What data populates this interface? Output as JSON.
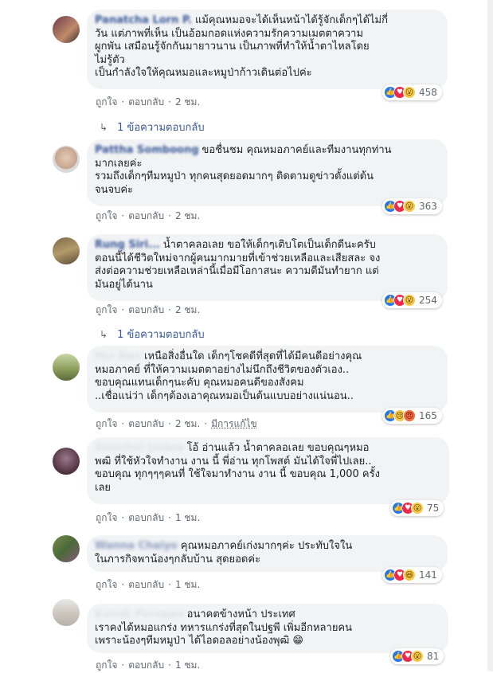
{
  "common": {
    "like_label": "ถูกใจ",
    "reply_label": "ตอบกลับ",
    "separator": "·"
  },
  "comments": [
    {
      "author": "Panatcha Lorn P.",
      "text": "แม้คุณหมอจะได้เห็นหน้าได้รู้จักเด็กๆได้ไม่กี่\nวัน แต่ภาพที่เห็น เป็นอ้อมกอดแห่งความรักความเมตตาความ\nผูกพัน เสมือนรู้จักกันมายาวนาน เป็นภาพที่ทำให้น้ำตาไหลโดย\nไม่รู้ตัว\nเป็นกำลังใจให้คุณหมอและหมูป่าก้าวเดินต่อไปค่ะ",
      "time": "2 ชม.",
      "reactions": {
        "icons": [
          "like",
          "love",
          "wow"
        ],
        "count": "458"
      },
      "replies": "1 ข้อความตอบกลับ"
    },
    {
      "author": "Pattha Somboong",
      "text": "ขอชื่นชม คุณหมอภาคย์และทีมงานทุกท่าน\nมากเลยค่ะ\nรวมถึงเด็กๆทีมหมูป่า ทุกคนสุดยอดมากๆ ติดตามดูข่าวตั้งแต่ต้น\nจนจบค่ะ",
      "time": "2 ชม.",
      "reactions": {
        "icons": [
          "like",
          "love",
          "wow"
        ],
        "count": "363"
      }
    },
    {
      "author": "Rung Siri...",
      "text": "น้ำตาคลอเลย ขอให้เด็กๆเติบโตเป็นเด็กดีนะครับ\nตอนนี้ได้ชีวิตใหม่จากผู้คนมากมายที่เข้าช่วยเหลือและเสียสละ จง\nส่งต่อความช่วยเหลือเหล่านี้เมื่อมีโอกาสนะ ความดีมันทำยาก แต่\nมันอยู่ได้นาน",
      "time": "2 ชม.",
      "reactions": {
        "icons": [
          "like",
          "love",
          "wow"
        ],
        "count": "254"
      },
      "replies": "1 ข้อความตอบกลับ"
    },
    {
      "author": "Nui Nan",
      "text": "เหนือสิ่งอื่นใด เด็กๆโชคดีที่สุดที่ได้มีคนดีอย่างคุณ\nหมอภาคย์ ที่ให้ความเมตตาอย่างไม่นึกถึงชีวิตของตัวเอง..\nขอบคุณแทนเด็กๆนะคับ คุณหมอคนดีของสังคม\n..เชื่อแน่ว่า เด็กๆต้องเอาคุณหมอเป็นต้นแบบอย่างแน่นอน..",
      "time": "2 ชม.",
      "edited": "มีการแก้ไข",
      "reactions": {
        "icons": [
          "like",
          "sad",
          "angry"
        ],
        "count": "165"
      }
    },
    {
      "author": "Somchai Jaidee",
      "text": "โอ้ อ่านแล้ว น้ำตาคลอเลย ขอบคุณๆหมอ\nพฒิ ที่ใช้หัวใจทำงาน งาน นี้ พี่อ่าน ทุกโพสต์ มันได้ใจพี่ไปเลย..\nขอบคุณ ทุกๆๆๆคนที่ ใช้ใจมาทำงาน งาน นี้ ขอบคุณ 1,000 ครั้ง\nเลย",
      "time": "1 ชม.",
      "reactions": {
        "icons": [
          "like",
          "love",
          "wow"
        ],
        "count": "75"
      }
    },
    {
      "author": "Wanna Chaiyo",
      "text": "คุณหมอภาคย์เก่งมากๆค่ะ ประทับใจใน\nในภารกิจพาน้องๆกลับบ้าน สุดยอดค่ะ",
      "time": "1 ชม.",
      "reactions": {
        "icons": [
          "like",
          "love",
          "haha"
        ],
        "count": "141"
      }
    },
    {
      "author": "Kanok Pornpan",
      "text": "อนาคตข้างหน้า ประเทศ\nเราคงได้หมอแกร่ง ทหารแกร่งที่สุดในปฐพี เพิ่มอีกหลายคน\nเพราะน้องๆทีมหมูป่า ได้ไอดอลอย่างน้องพุฒิ 😁",
      "time": "1 ชม.",
      "reactions": {
        "icons": [
          "like",
          "love",
          "wow"
        ],
        "count": "81"
      }
    }
  ]
}
